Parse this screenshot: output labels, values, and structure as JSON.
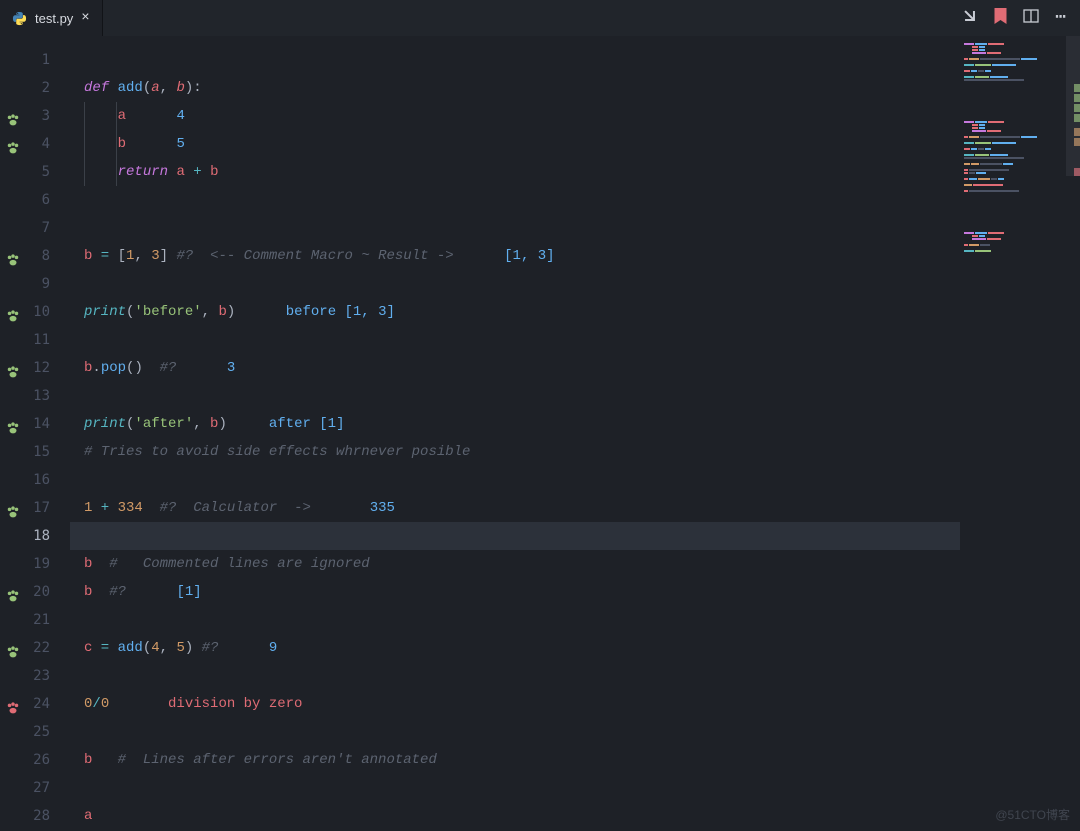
{
  "tab": {
    "filename": "test.py"
  },
  "icons": {
    "python": "python-icon",
    "close": "×",
    "compare": "compare-changes-icon",
    "bookmark": "bookmark-icon",
    "split": "split-editor-icon",
    "more": "⋯"
  },
  "gutter": {
    "lines": [
      {
        "n": "1",
        "paw": ""
      },
      {
        "n": "2",
        "paw": ""
      },
      {
        "n": "3",
        "paw": "green"
      },
      {
        "n": "4",
        "paw": "green"
      },
      {
        "n": "5",
        "paw": ""
      },
      {
        "n": "6",
        "paw": ""
      },
      {
        "n": "7",
        "paw": ""
      },
      {
        "n": "8",
        "paw": "green"
      },
      {
        "n": "9",
        "paw": ""
      },
      {
        "n": "10",
        "paw": "green"
      },
      {
        "n": "11",
        "paw": ""
      },
      {
        "n": "12",
        "paw": "green"
      },
      {
        "n": "13",
        "paw": ""
      },
      {
        "n": "14",
        "paw": "green"
      },
      {
        "n": "15",
        "paw": ""
      },
      {
        "n": "16",
        "paw": ""
      },
      {
        "n": "17",
        "paw": "green"
      },
      {
        "n": "18",
        "paw": ""
      },
      {
        "n": "19",
        "paw": ""
      },
      {
        "n": "20",
        "paw": "green"
      },
      {
        "n": "21",
        "paw": ""
      },
      {
        "n": "22",
        "paw": "green"
      },
      {
        "n": "23",
        "paw": ""
      },
      {
        "n": "24",
        "paw": "red"
      },
      {
        "n": "25",
        "paw": ""
      },
      {
        "n": "26",
        "paw": ""
      },
      {
        "n": "27",
        "paw": ""
      },
      {
        "n": "28",
        "paw": ""
      }
    ]
  },
  "code": {
    "l1": "",
    "l2": {
      "def": "def",
      "fn": "add",
      "lp": "(",
      "a": "a",
      "c1": ", ",
      "b": "b",
      "rp": "):"
    },
    "l3": {
      "var": "a",
      "val": "4"
    },
    "l4": {
      "var": "b",
      "val": "5"
    },
    "l5": {
      "kw": "return",
      "a": "a",
      "op": " + ",
      "b": "b"
    },
    "l8": {
      "v": "b",
      "eq": " = ",
      "lb": "[",
      "n1": "1",
      "c": ", ",
      "n2": "3",
      "rb": "]",
      "cmt": " #?  <-- Comment Macro ~ Result ->",
      "res": "[1, 3]"
    },
    "l10": {
      "fn": "print",
      "lp": "(",
      "s": "'before'",
      "c": ", ",
      "v": "b",
      "rp": ")",
      "res": "before [1, 3]"
    },
    "l12": {
      "v": "b",
      "dot": ".",
      "m": "pop",
      "lp": "(",
      "rp": ")",
      "cmt": "  #?",
      "res": "3"
    },
    "l14": {
      "fn": "print",
      "lp": "(",
      "s": "'after'",
      "c": ", ",
      "v": "b",
      "rp": ")",
      "res": "after [1]"
    },
    "l15": "# Tries to avoid side effects whrnever posible",
    "l17": {
      "n1": "1",
      "op": " + ",
      "n2": "334",
      "cmt": "  #?  Calculator  ->",
      "res": "335"
    },
    "l19": {
      "v": "b",
      "cmt": "  #   Commented lines are ignored"
    },
    "l20": {
      "v": "b",
      "cmt": "  #?",
      "res": "[1]"
    },
    "l22": {
      "v": "c",
      "eq": " = ",
      "fn": "add",
      "lp": "(",
      "n1": "4",
      "c": ", ",
      "n2": "5",
      "rp": ")",
      "cmt": " #?",
      "res": "9"
    },
    "l24": {
      "n1": "0",
      "op": "/",
      "n2": "0",
      "err": "division by zero"
    },
    "l26": {
      "v": "b",
      "cmt": "   #  Lines after errors aren't annotated"
    },
    "l28": {
      "v": "a"
    }
  },
  "watermark": "@51CTO博客"
}
